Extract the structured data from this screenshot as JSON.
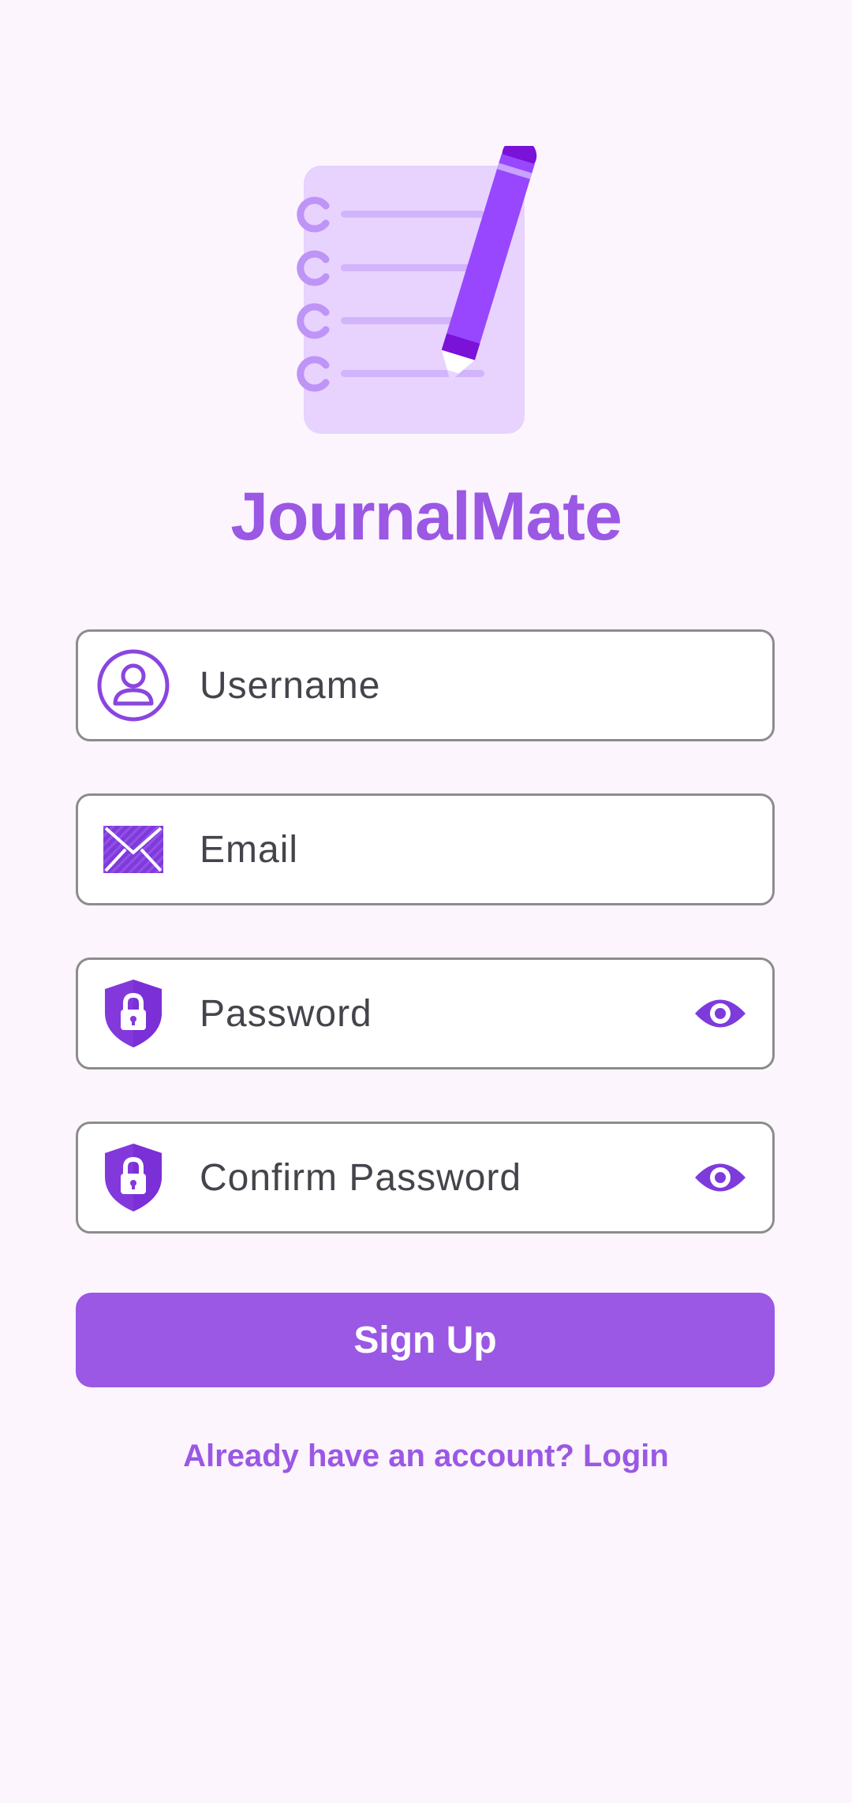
{
  "app": {
    "title": "JournalMate",
    "logo_icon": "notebook-pencil-icon"
  },
  "form": {
    "username": {
      "placeholder": "Username",
      "value": "",
      "icon": "user-icon"
    },
    "email": {
      "placeholder": "Email",
      "value": "",
      "icon": "envelope-icon"
    },
    "password": {
      "placeholder": "Password",
      "value": "",
      "icon": "shield-lock-icon",
      "toggle_icon": "eye-icon"
    },
    "confirm_password": {
      "placeholder": "Confirm Password",
      "value": "",
      "icon": "shield-lock-icon",
      "toggle_icon": "eye-icon"
    }
  },
  "actions": {
    "signup_label": "Sign Up",
    "login_link": "Already have an account? Login"
  },
  "colors": {
    "background": "#FDF5FD",
    "accent": "#9A58E4",
    "icon": "#7E3BDB",
    "border": "#8C8C8C"
  }
}
